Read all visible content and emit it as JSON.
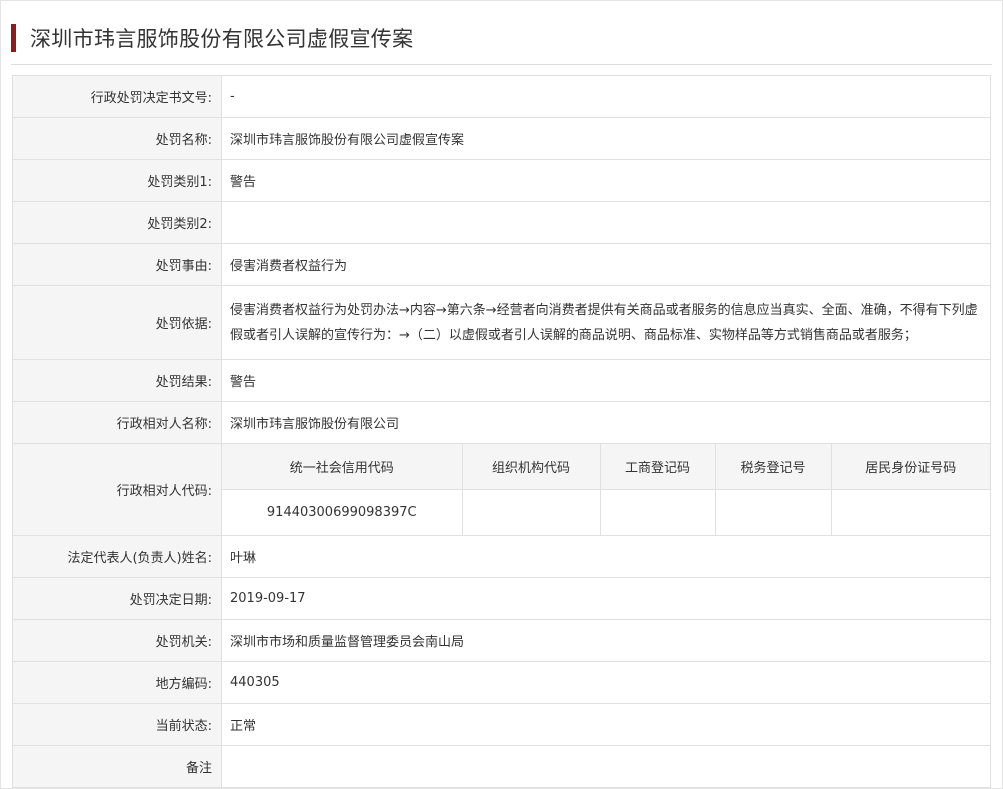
{
  "title": "深圳市玮言服饰股份有限公司虚假宣传案",
  "fields": {
    "decision_no": {
      "label": "行政处罚决定书文号:",
      "value": "-"
    },
    "penalty_name": {
      "label": "处罚名称:",
      "value": "深圳市玮言服饰股份有限公司虚假宣传案"
    },
    "category1": {
      "label": "处罚类别1:",
      "value": "警告"
    },
    "category2": {
      "label": "处罚类别2:",
      "value": ""
    },
    "reason": {
      "label": "处罚事由:",
      "value": "侵害消费者权益行为"
    },
    "basis": {
      "label": "处罚依据:",
      "value": "侵害消费者权益行为处罚办法→内容→第六条→经营者向消费者提供有关商品或者服务的信息应当真实、全面、准确，不得有下列虚假或者引人误解的宣传行为：→（二）以虚假或者引人误解的商品说明、商品标准、实物样品等方式销售商品或者服务；"
    },
    "result": {
      "label": "处罚结果:",
      "value": "警告"
    },
    "party_name": {
      "label": "行政相对人名称:",
      "value": "深圳市玮言服饰股份有限公司"
    },
    "party_code": {
      "label": "行政相对人代码:",
      "headers": [
        "统一社会信用代码",
        "组织机构代码",
        "工商登记码",
        "税务登记号",
        "居民身份证号码"
      ],
      "values": [
        "91440300699098397C",
        "",
        "",
        "",
        ""
      ]
    },
    "legal_rep": {
      "label": "法定代表人(负责人)姓名:",
      "value": "叶琳"
    },
    "decision_date": {
      "label": "处罚决定日期:",
      "value": "2019-09-17"
    },
    "authority": {
      "label": "处罚机关:",
      "value": "深圳市市场和质量监督管理委员会南山局"
    },
    "region_code": {
      "label": "地方编码:",
      "value": "440305"
    },
    "status": {
      "label": "当前状态:",
      "value": "正常"
    },
    "remarks": {
      "label": "备注",
      "value": ""
    }
  },
  "colors": {
    "accent": "#8b1d1d",
    "label_bg": "#f5f5f5",
    "border": "#e0e0e0"
  }
}
